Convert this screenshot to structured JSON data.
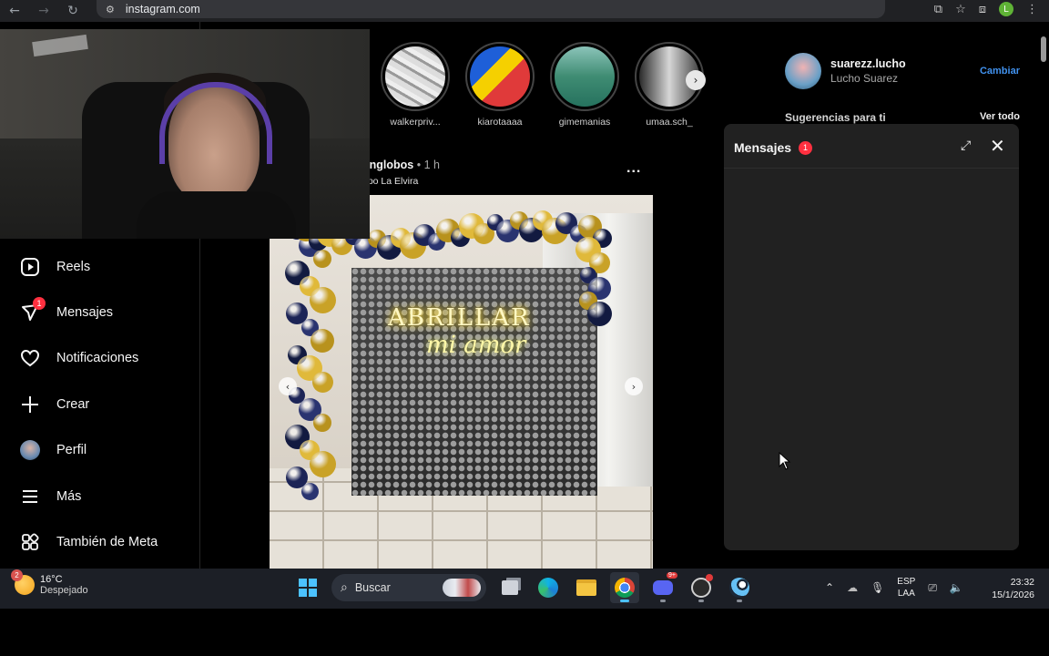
{
  "browser": {
    "url": "instagram.com",
    "profile_initial": "L",
    "icons": [
      "back-icon",
      "forward-icon",
      "reload-icon",
      "site-info-icon",
      "install-icon",
      "bookmark-star-icon",
      "extensions-icon",
      "menu-dots-icon"
    ]
  },
  "stories": [
    {
      "name": "walkerpriv..."
    },
    {
      "name": "kiarotaaaa"
    },
    {
      "name": "gimemanias"
    },
    {
      "name": "umaa.sch_"
    }
  ],
  "post": {
    "username": "onglobos",
    "separator": " • ",
    "time": "1 h",
    "location": "npo La Elvira",
    "more": "...",
    "neon_line1": "ABRILLAR",
    "neon_line2": "mi amor"
  },
  "nav": {
    "items": [
      {
        "label": "Reels",
        "icon": "reels-icon"
      },
      {
        "label": "Mensajes",
        "icon": "messenger-icon",
        "badge": "1"
      },
      {
        "label": "Notificaciones",
        "icon": "heart-icon"
      },
      {
        "label": "Crear",
        "icon": "plus-icon"
      },
      {
        "label": "Perfil",
        "icon": "avatar-icon"
      },
      {
        "label": "Más",
        "icon": "hamburger-icon"
      },
      {
        "label": "También de Meta",
        "icon": "meta-apps-icon"
      }
    ]
  },
  "account": {
    "username": "suarezz.lucho",
    "fullname": "Lucho Suarez",
    "switch_label": "Cambiar"
  },
  "suggestions": {
    "title": "Sugerencias para ti",
    "see_all": "Ver todo"
  },
  "messages_panel": {
    "title": "Mensajes",
    "badge": "1"
  },
  "taskbar": {
    "weather_badge": "2",
    "temperature": "16°C",
    "condition": "Despejado",
    "search_placeholder": "Buscar",
    "discord_badge": "9+",
    "lang_top": "ESP",
    "lang_bottom": "LAA",
    "time": "23:32",
    "date": "15/1/2026"
  }
}
